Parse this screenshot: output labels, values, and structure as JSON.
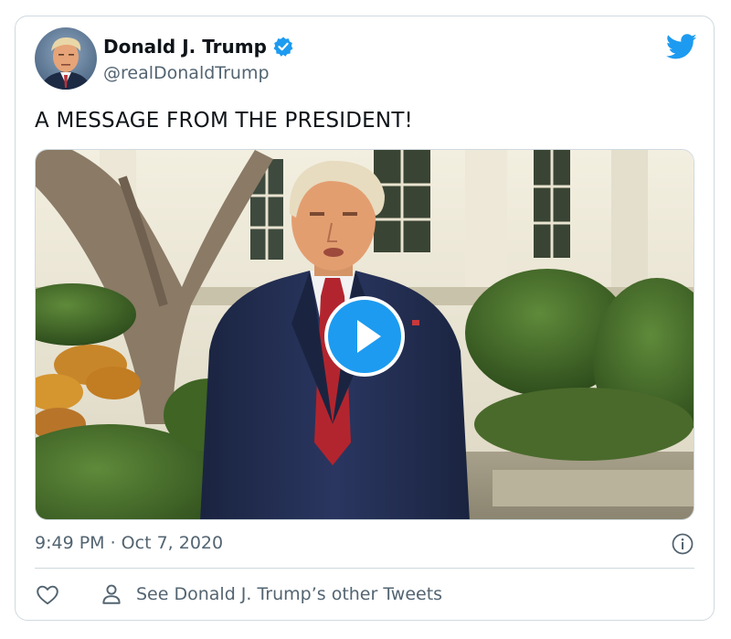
{
  "author": {
    "display_name": "Donald J. Trump",
    "handle": "@realDonaldTrump",
    "verified": true
  },
  "tweet": {
    "text": "A MESSAGE FROM THE PRESIDENT!",
    "timestamp": "9:49 PM · Oct 7, 2020"
  },
  "media": {
    "type": "video",
    "play_icon": "play-icon"
  },
  "actions": {
    "like_icon": "heart-icon",
    "other_tweets_label": "See Donald J. Trump’s other Tweets",
    "other_tweets_icon": "person-icon"
  },
  "icons": {
    "brand": "twitter-bird-icon",
    "verified": "verified-badge-icon",
    "info": "info-icon"
  },
  "colors": {
    "brand_blue": "#1d9bf0",
    "text_primary": "#0f1419",
    "text_secondary": "#536471",
    "border": "#cfd9de"
  }
}
